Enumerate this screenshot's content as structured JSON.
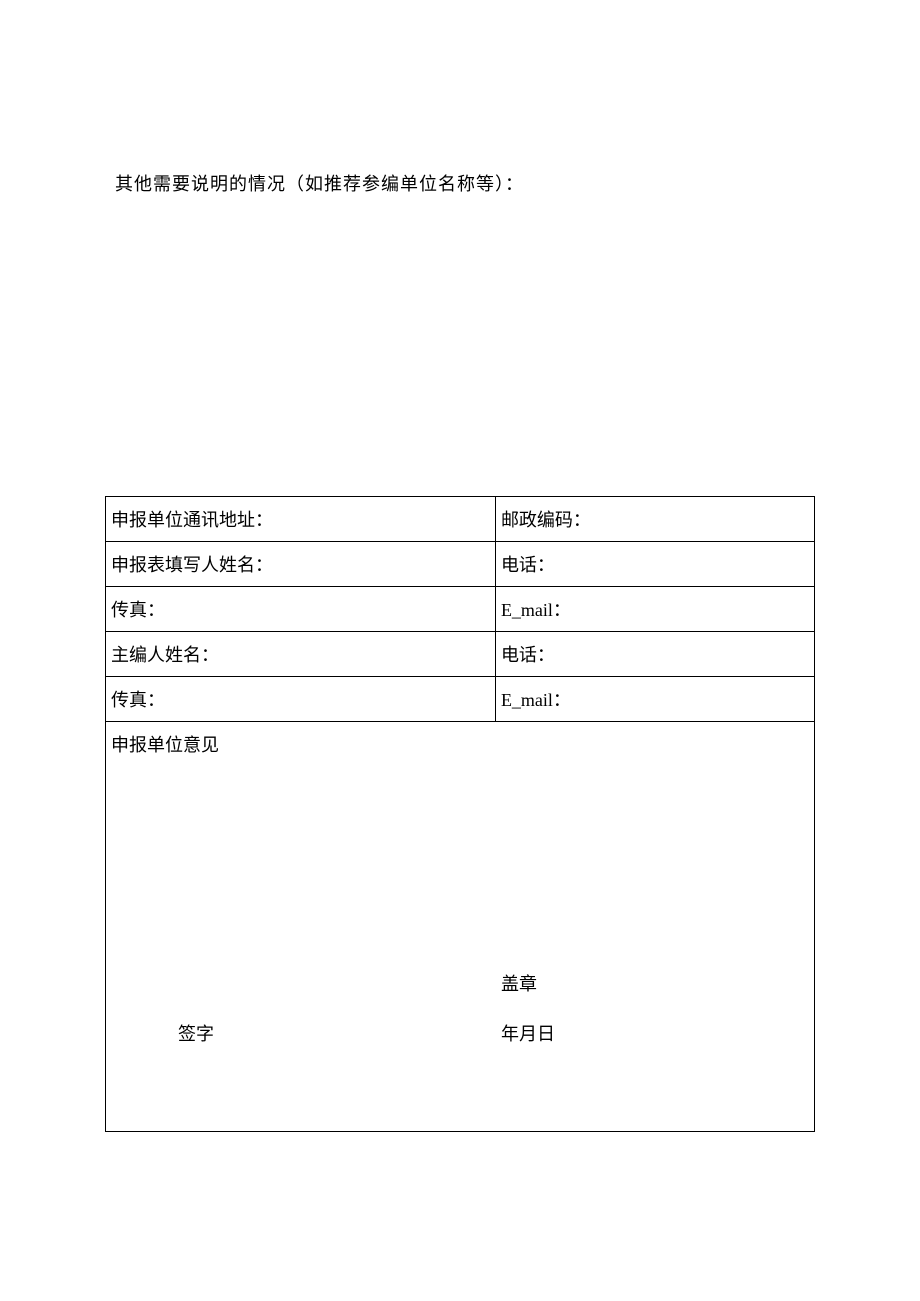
{
  "intro": "其他需要说明的情况（如推荐参编单位名称等）：",
  "rows": [
    {
      "left": "申报单位通讯地址：",
      "right": "邮政编码："
    },
    {
      "left": "申报表填写人姓名：",
      "right": "电话："
    },
    {
      "left": "传真：",
      "right": "E_mail："
    },
    {
      "left": "主编人姓名：",
      "right": "电话："
    },
    {
      "left": "传真：",
      "right": "E_mail："
    }
  ],
  "opinion": {
    "label": "申报单位意见",
    "stamp": "盖章",
    "sign": "签字",
    "date": "年月日"
  }
}
